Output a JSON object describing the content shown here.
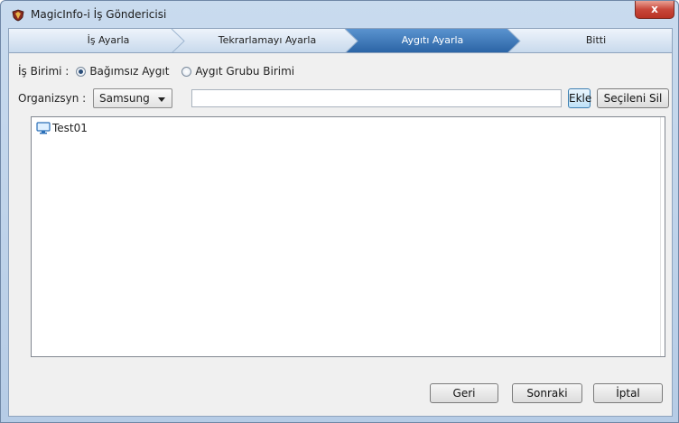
{
  "window": {
    "title": "MagicInfo-i İş Göndericisi",
    "close_label": "x"
  },
  "steps": [
    {
      "label": "İş Ayarla",
      "active": false
    },
    {
      "label": "Tekrarlamayı Ayarla",
      "active": false
    },
    {
      "label": "Aygıtı Ayarla",
      "active": true
    },
    {
      "label": "Bitti",
      "active": false
    }
  ],
  "form": {
    "unit_label": "İş Birimi :",
    "unit_options": [
      {
        "label": "Bağımsız Aygıt",
        "selected": true
      },
      {
        "label": "Aygıt Grubu Birimi",
        "selected": false
      }
    ],
    "org_label": "Organizsyn :",
    "org_select_value": "Samsung",
    "search_value": "",
    "add_label": "Ekle",
    "remove_label": "Seçileni Sil"
  },
  "devices": [
    {
      "name": "Test01",
      "icon": "monitor-icon"
    }
  ],
  "footer": {
    "back_label": "Geri",
    "next_label": "Sonraki",
    "cancel_label": "İptal"
  },
  "colors": {
    "step_active": "#2f6fb0",
    "step_inactive": "#d6e4f2",
    "close_button": "#c8473a"
  }
}
